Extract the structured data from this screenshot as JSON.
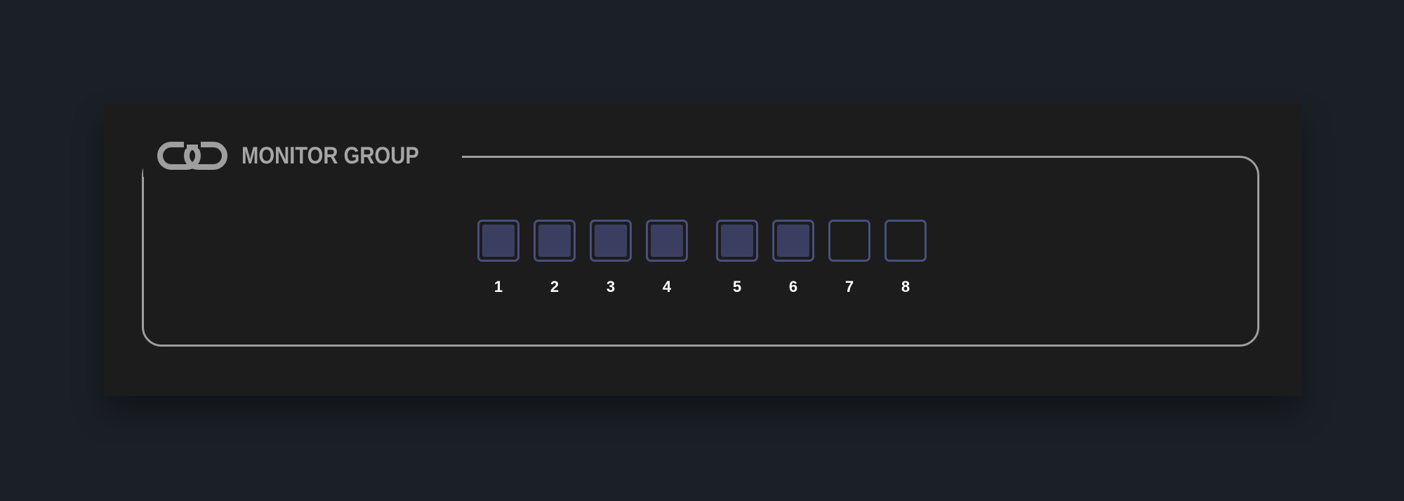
{
  "group": {
    "title": "MONITOR GROUP",
    "icon": "link-icon",
    "frame_color": "#9e9e9e"
  },
  "channels": [
    {
      "label": "1",
      "active": true
    },
    {
      "label": "2",
      "active": true
    },
    {
      "label": "3",
      "active": true
    },
    {
      "label": "4",
      "active": true
    },
    {
      "label": "5",
      "active": true
    },
    {
      "label": "6",
      "active": true
    },
    {
      "label": "7",
      "active": false
    },
    {
      "label": "8",
      "active": false
    }
  ],
  "colors": {
    "background": "#1b2027",
    "panel": "#1c1c1c",
    "button_border": "#48507c",
    "button_active_fill": "#3a3f62",
    "label_text": "#ffffff",
    "title_text": "#a6a6a6"
  }
}
